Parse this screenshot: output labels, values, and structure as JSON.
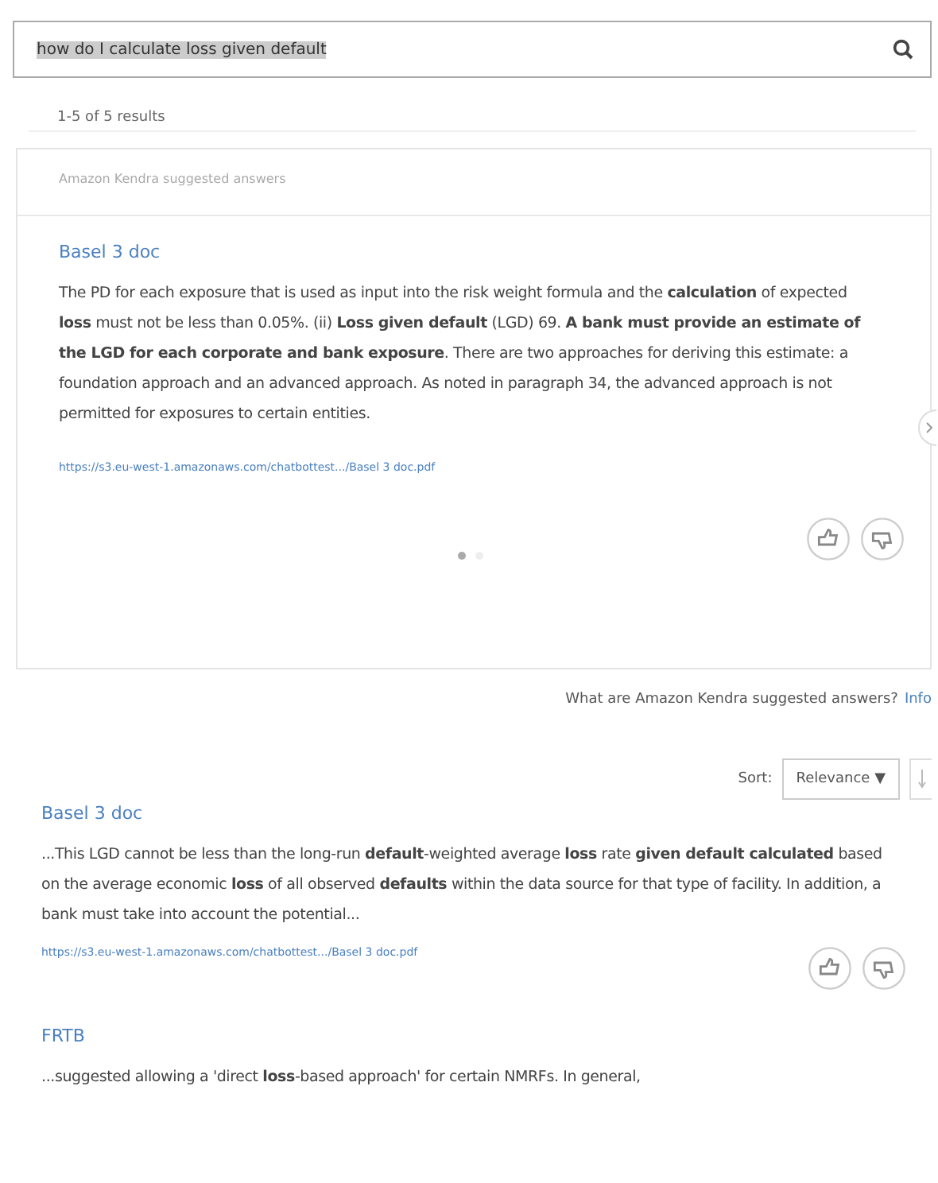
{
  "search": {
    "value": "how do I calculate loss given default"
  },
  "results_count": "1-5 of 5 results",
  "suggested": {
    "header": "Amazon Kendra suggested answers",
    "title": "Basel 3 doc",
    "excerpt": "The PD for each exposure that is used as input into the risk weight formula and the **calculation** of expected **loss** must not be less than 0.05%. (ii) **Loss given default** (LGD) 69. **A bank must provide an estimate of the LGD for each corporate and bank exposure**. There are two approaches for deriving this estimate: a foundation approach and an advanced approach. As noted in paragraph 34, the advanced approach is not permitted for exposures to certain entities.",
    "url": "https://s3.eu-west-1.amazonaws.com/chatbottest.../Basel 3 doc.pdf",
    "dots": [
      {
        "selected": true
      },
      {
        "selected": false
      }
    ]
  },
  "help": {
    "question": "What are Amazon Kendra suggested answers?",
    "link": "Info"
  },
  "sort": {
    "label": "Sort:",
    "value": "Relevance ▼"
  },
  "results": [
    {
      "title": "Basel 3 doc",
      "excerpt": "...This LGD cannot be less than the long-run **default**-weighted average **loss** rate **given default calculated** based on the average economic **loss** of all observed **defaults** within the data source for that type of facility. In addition, a bank must take into account the potential...",
      "url": "https://s3.eu-west-1.amazonaws.com/chatbottest.../Basel 3 doc.pdf"
    },
    {
      "title": "FRTB",
      "excerpt": "...suggested allowing a 'direct **loss**-based approach' for certain NMRFs. In general,"
    }
  ]
}
